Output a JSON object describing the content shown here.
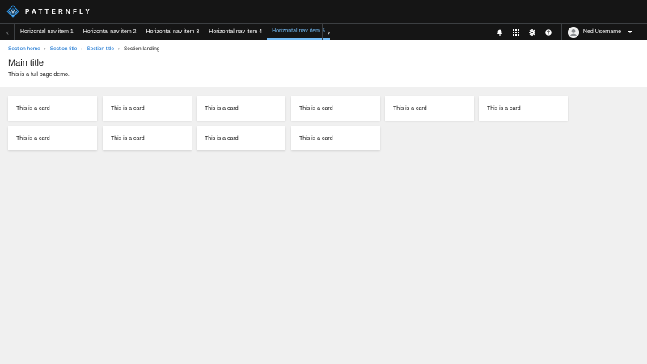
{
  "brand": {
    "name": "PATTERNFLY",
    "accent": "#73bcf7"
  },
  "nav": {
    "prev_icon": "chevron-left-icon",
    "next_icon": "chevron-right-icon",
    "items": [
      {
        "label": "Horizontal nav item 1"
      },
      {
        "label": "Horizontal nav item 2"
      },
      {
        "label": "Horizontal nav item 3"
      },
      {
        "label": "Horizontal nav item 4"
      },
      {
        "label": "Horizontal nav item 5",
        "active": true
      }
    ]
  },
  "toolbar": {
    "icons": [
      "bell-icon",
      "grid-icon",
      "gear-icon",
      "help-icon"
    ],
    "user_name": "Ned Username"
  },
  "breadcrumb": {
    "links": [
      "Section home",
      "Section title",
      "Section title"
    ],
    "current": "Section landing"
  },
  "page": {
    "title": "Main title",
    "description": "This is a full page demo."
  },
  "cards": [
    {
      "text": "This is a card"
    },
    {
      "text": "This is a card"
    },
    {
      "text": "This is a card"
    },
    {
      "text": "This is a card"
    },
    {
      "text": "This is a card"
    },
    {
      "text": "This is a card"
    },
    {
      "text": "This is a card"
    },
    {
      "text": "This is a card"
    },
    {
      "text": "This is a card"
    },
    {
      "text": "This is a card"
    }
  ],
  "colors": {
    "masthead": "#151515",
    "link": "#0066cc",
    "active_nav": "#73bcf7",
    "page_background": "#f0f0f0"
  }
}
